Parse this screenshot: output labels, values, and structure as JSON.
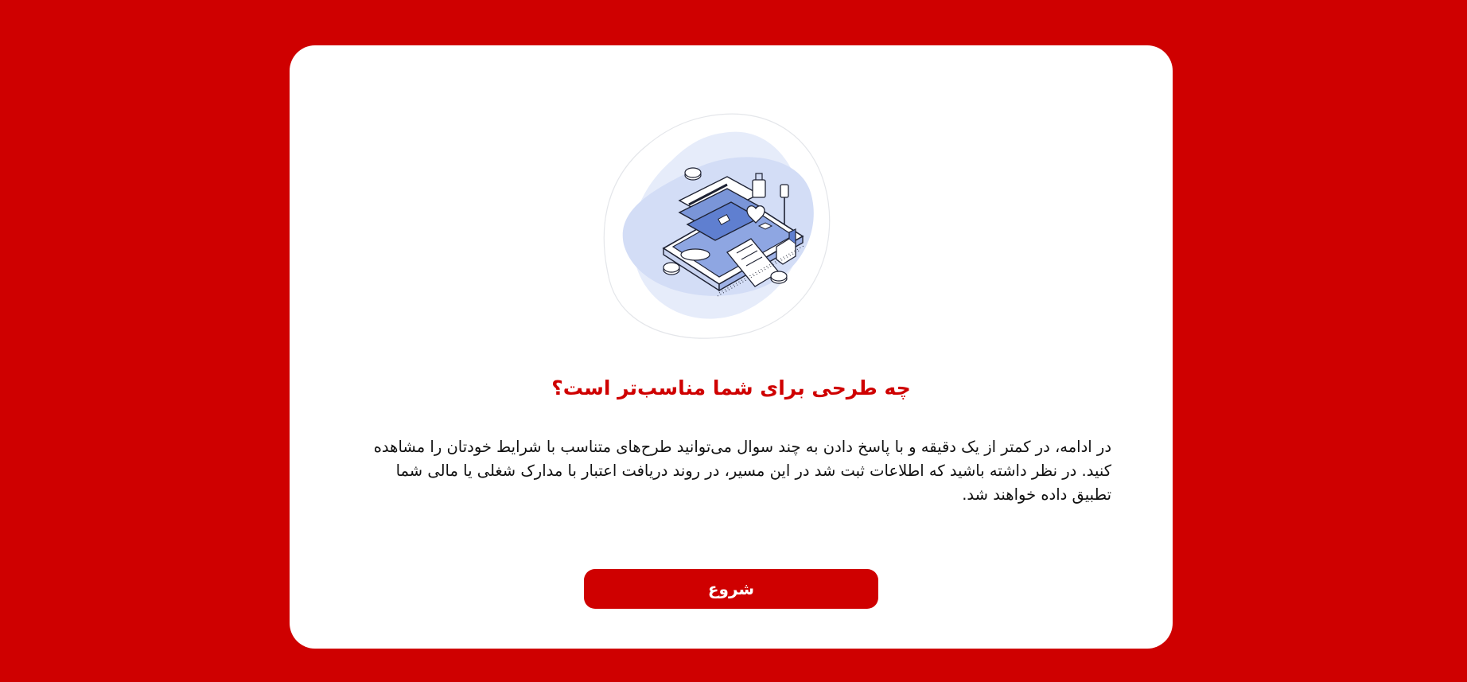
{
  "colors": {
    "brand": "#cf0000",
    "card_background": "#ffffff",
    "text": "#111111",
    "illustration_blob": "#d6e0f7",
    "illustration_accent": "#7a95d8"
  },
  "illustration": {
    "icon": "financial-services-isometric-illustration"
  },
  "main": {
    "title": "چه طرحی برای شما مناسب‌تر است؟",
    "description": "در ادامه، در کمتر از یک دقیقه و با پاسخ دادن به چند سوال می‌توانید طرح‌های متناسب با شرایط خودتان را مشاهده کنید. در نظر داشته باشید که اطلاعات ثبت شد در این مسیر، در روند دریافت اعتبار با مدارک شغلی یا مالی شما تطبیق داده خواهند شد.",
    "start_button_label": "شروع"
  }
}
